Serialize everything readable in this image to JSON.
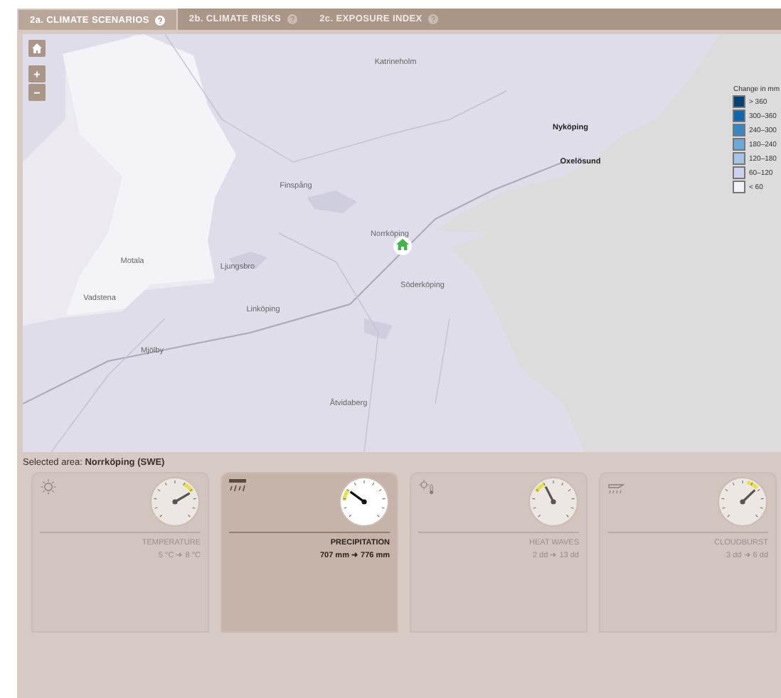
{
  "tabs": [
    {
      "label": "2a. CLIMATE SCENARIOS",
      "selected": true
    },
    {
      "label": "2b. CLIMATE RISKS",
      "selected": false
    },
    {
      "label": "2c. EXPOSURE INDEX",
      "selected": false
    }
  ],
  "map": {
    "zoom_in": "+",
    "zoom_out": "−",
    "places": [
      "Katrineholm",
      "Finspång",
      "Norrköping",
      "Söderköping",
      "Ljungsbro",
      "Linköping",
      "Motala",
      "Vadstena",
      "Mjölby",
      "Åtvidaberg",
      "Nyköping",
      "Oxelösund"
    ],
    "legend": {
      "title": "Change in mm",
      "items": [
        {
          "label": "> 360",
          "color": "#08406e"
        },
        {
          "label": "300–360",
          "color": "#1265a8"
        },
        {
          "label": "240–300",
          "color": "#3a86c2"
        },
        {
          "label": "180–240",
          "color": "#70a6d6"
        },
        {
          "label": "120–180",
          "color": "#a6c3e6"
        },
        {
          "label": "60–120",
          "color": "#cdd3ee"
        },
        {
          "label": "< 60",
          "color": "#f3f3f7"
        }
      ]
    }
  },
  "selected_area": {
    "label": "Selected area:",
    "value": "Norrköping (SWE)"
  },
  "indicators": [
    {
      "kind": "temperature",
      "title": "TEMPERATURE",
      "values": "5 °C ➜ 8 °C",
      "level": 0.72,
      "selected": false
    },
    {
      "kind": "precipitation",
      "title": "PRECIPITATION",
      "values": "707 mm ➜ 776 mm",
      "level": 0.3,
      "selected": true
    },
    {
      "kind": "heatwaves",
      "title": "HEAT WAVES",
      "values": "2 dd ➜ 13 dd",
      "level": 0.4,
      "selected": false
    },
    {
      "kind": "cloudburst",
      "title": "CLOUDBURST",
      "values": "3 dd ➜ 6 dd",
      "level": 0.67,
      "selected": false
    }
  ]
}
